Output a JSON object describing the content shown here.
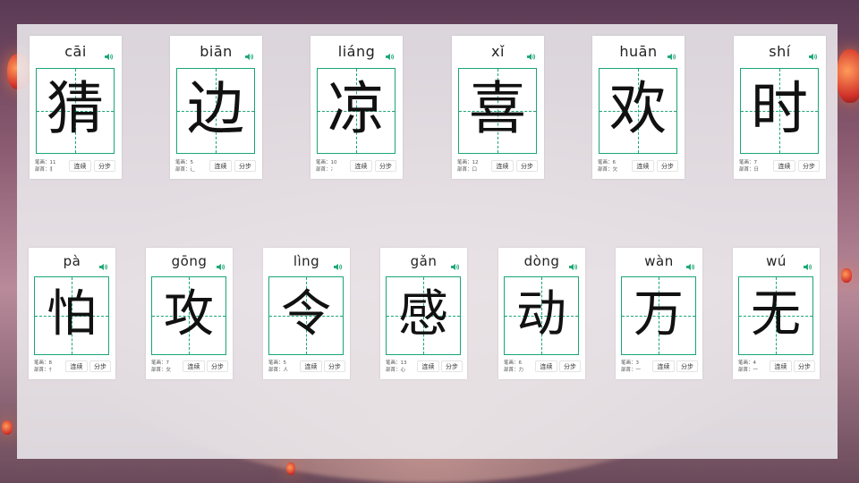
{
  "labels": {
    "strokes": "笔画：",
    "radical": "部首：",
    "continuous": "连续",
    "step": "分步"
  },
  "cards": [
    {
      "pinyin": "cāi",
      "char": "猜",
      "strokes": "11",
      "radical": "犭"
    },
    {
      "pinyin": "biān",
      "char": "边",
      "strokes": "5",
      "radical": "辶"
    },
    {
      "pinyin": "liáng",
      "char": "凉",
      "strokes": "10",
      "radical": "冫"
    },
    {
      "pinyin": "xǐ",
      "char": "喜",
      "strokes": "12",
      "radical": "口"
    },
    {
      "pinyin": "huān",
      "char": "欢",
      "strokes": "6",
      "radical": "欠"
    },
    {
      "pinyin": "shí",
      "char": "时",
      "strokes": "7",
      "radical": "日"
    },
    {
      "pinyin": "pà",
      "char": "怕",
      "strokes": "8",
      "radical": "忄"
    },
    {
      "pinyin": "gōng",
      "char": "攻",
      "strokes": "7",
      "radical": "攵"
    },
    {
      "pinyin": "lìng",
      "char": "令",
      "strokes": "5",
      "radical": "人"
    },
    {
      "pinyin": "gǎn",
      "char": "感",
      "strokes": "13",
      "radical": "心"
    },
    {
      "pinyin": "dòng",
      "char": "动",
      "strokes": "6",
      "radical": "力"
    },
    {
      "pinyin": "wàn",
      "char": "万",
      "strokes": "3",
      "radical": "一"
    },
    {
      "pinyin": "wú",
      "char": "无",
      "strokes": "4",
      "radical": "一"
    }
  ],
  "colors": {
    "grid": "#1aa673",
    "speaker": "#1aa673"
  },
  "icons": {
    "speaker": "speaker-icon"
  }
}
